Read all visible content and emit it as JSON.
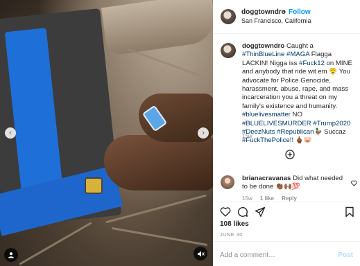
{
  "post": {
    "username": "doggtowndro",
    "follow_label": "Follow",
    "separator": "•",
    "location": "San Francisco, California",
    "caption_segments": [
      {
        "text": "Caught a ",
        "tag": false
      },
      {
        "text": "#ThinBlueLine",
        "tag": true
      },
      {
        "text": " ",
        "tag": false
      },
      {
        "text": "#MAGA",
        "tag": true
      },
      {
        "text": " Flagga LACKIN! Nigga iss ",
        "tag": false
      },
      {
        "text": "#Fuck12",
        "tag": true
      },
      {
        "text": " on MINE and anybody that ride wit em 😤 You advocate for Police Genocide, harassment, abuse, rape, and mass incarceration you a threat on my family's existence and humanity. ",
        "tag": false
      },
      {
        "text": "#bluelivesmatter",
        "tag": true
      },
      {
        "text": " NO ",
        "tag": false
      },
      {
        "text": "#BLUELIVESMURDER",
        "tag": true
      },
      {
        "text": " ",
        "tag": false
      },
      {
        "text": "#Trump2020",
        "tag": true
      },
      {
        "text": " ",
        "tag": false
      },
      {
        "text": "#DeezNuts",
        "tag": true
      },
      {
        "text": " ",
        "tag": false
      },
      {
        "text": "#Republican",
        "tag": true
      },
      {
        "text": "🦆 Succaz ",
        "tag": false
      },
      {
        "text": "#FuckThePolice!!",
        "tag": true
      },
      {
        "text": " 🖕🏾🐷",
        "tag": false
      }
    ],
    "caption_age": "15w",
    "likes": "108 likes",
    "date": "JUNE 30"
  },
  "comment": {
    "username": "brianacravanas",
    "text": " Did what needed to be done 👏🏾🙌🏾💯",
    "age": "15w",
    "likes": "1 like",
    "reply_label": "Reply"
  },
  "add_comment": {
    "placeholder": "Add a comment…",
    "post_label": "Post"
  },
  "icons": [
    "heart-icon",
    "comment-icon",
    "share-icon",
    "bookmark-icon",
    "add-comments-icon",
    "profile-tag-icon",
    "sound-icon",
    "carousel-prev-icon",
    "carousel-next-icon"
  ],
  "colors": {
    "link": "#0095f6",
    "tag": "#00376b",
    "muted": "#8e8e8e",
    "post_disabled": "#b2dffc"
  }
}
